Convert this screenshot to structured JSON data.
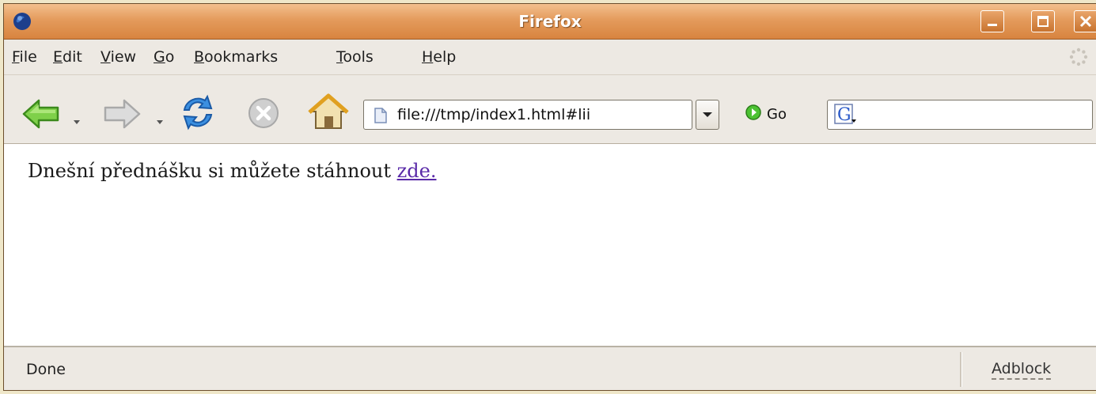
{
  "window": {
    "title": "Firefox"
  },
  "menubar": {
    "items": [
      {
        "label": "File",
        "mnemonic": "F",
        "rest": "ile"
      },
      {
        "label": "Edit",
        "mnemonic": "E",
        "rest": "dit"
      },
      {
        "label": "View",
        "mnemonic": "V",
        "rest": "iew"
      },
      {
        "label": "Go",
        "mnemonic": "G",
        "rest": "o"
      },
      {
        "label": "Bookmarks",
        "mnemonic": "B",
        "rest": "ookmarks"
      },
      {
        "label": "Tools",
        "mnemonic": "T",
        "rest": "ools"
      },
      {
        "label": "Help",
        "mnemonic": "H",
        "rest": "elp"
      }
    ]
  },
  "toolbar": {
    "back_icon": "back-arrow-icon",
    "forward_icon": "forward-arrow-icon",
    "reload_icon": "reload-icon",
    "stop_icon": "stop-icon",
    "home_icon": "home-icon",
    "url": "file:///tmp/index1.html#lii",
    "go_label": "Go",
    "search_engine_icon": "google-icon",
    "search_value": ""
  },
  "content": {
    "text": "Dnešní přednášku si můžete stáhnout ",
    "link_text": "zde.",
    "link_color": "#5a2aa8"
  },
  "statusbar": {
    "status": "Done",
    "adblock_label": "Adblock"
  }
}
